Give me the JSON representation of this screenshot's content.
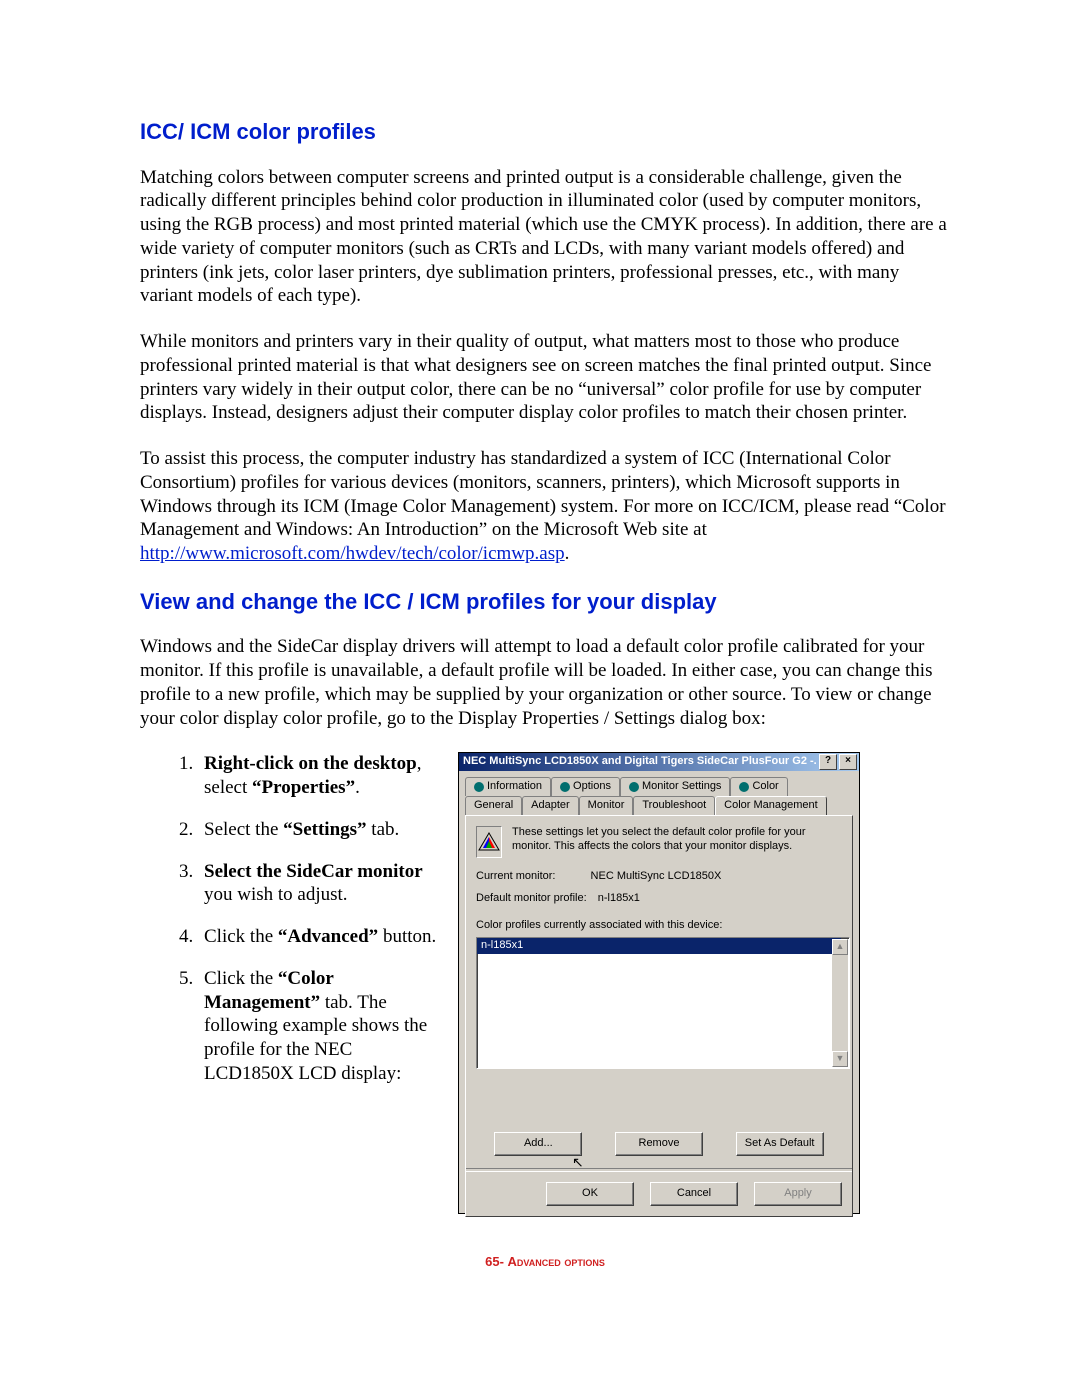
{
  "doc": {
    "h1": "ICC/ ICM color profiles",
    "p1": "Matching colors between computer screens and printed output is a considerable challenge, given the radically different principles behind color production in illuminated color (used by computer monitors, using the RGB process) and most printed material (which use the CMYK process). In addition, there are a wide variety of computer monitors (such as CRTs and LCDs, with many variant models offered) and printers (ink jets, color laser printers, dye sublimation printers, professional presses, etc., with many variant models of each type).",
    "p2": "While monitors and printers vary in their quality of output, what matters most to those who produce professional printed material is that what designers see on screen matches the final printed output. Since printers vary widely in their output color, there can be no “universal” color profile for use by computer displays. Instead, designers adjust their computer display color profiles to match their chosen printer.",
    "p3a": "To assist this process, the computer industry has standardized a system of ICC (International Color Consortium) profiles for various devices (monitors, scanners, printers), which Microsoft supports in Windows through its ICM (Image Color Management) system. For more on ICC/ICM, please read “Color Management and Windows: An Introduction” on the Microsoft Web site at ",
    "p3link": "http://www.microsoft.com/hwdev/tech/color/icmwp.asp",
    "p3b": ".",
    "h2": "View and change the ICC / ICM profiles for your display",
    "p4": "Windows and the SideCar display drivers will attempt to load a default color profile calibrated for your monitor. If this profile is unavailable, a default profile will be loaded. In either case, you can change this profile to a new profile, which may be supplied by your organization or other source. To view or change your color display color profile, go to the Display Properties / Settings dialog box:",
    "steps": {
      "s1a": "Right-click on the desktop",
      "s1b": ", select ",
      "s1c": "“Properties”",
      "s1d": ".",
      "s2a": "Select the ",
      "s2b": "“Settings”",
      "s2c": " tab.",
      "s3a": "Select the SideCar monitor",
      "s3b": " you wish to adjust.",
      "s4a": "Click the ",
      "s4b": "“Advanced”",
      "s4c": " button.",
      "s5a": "Click the ",
      "s5b": "“Color Management”",
      "s5c": " tab. The following example shows the profile for the NEC LCD1850X LCD display:"
    }
  },
  "dialog": {
    "title": "NEC MultiSync LCD1850X and Digital Tigers SideCar PlusFour G2  -...",
    "help": "?",
    "close": "×",
    "tabs_top": [
      "Information",
      "Options",
      "Monitor Settings",
      "Color"
    ],
    "tabs_bot": [
      "General",
      "Adapter",
      "Monitor",
      "Troubleshoot",
      "Color Management"
    ],
    "desc": "These settings let you select the default color profile for your monitor. This affects the colors that your monitor displays.",
    "curmon_k": "Current monitor:",
    "curmon_v": "NEC MultiSync LCD1850X",
    "defprof_k": "Default monitor profile:",
    "defprof_v": "n-l185x1",
    "assoc": "Color profiles currently associated with this device:",
    "listitem": "n-l185x1",
    "btn_add": "Add...",
    "btn_remove": "Remove",
    "btn_setdef": "Set As Default",
    "btn_ok": "OK",
    "btn_cancel": "Cancel",
    "btn_apply": "Apply"
  },
  "footer": {
    "num": "65- ",
    "txt": "Advanced options"
  }
}
